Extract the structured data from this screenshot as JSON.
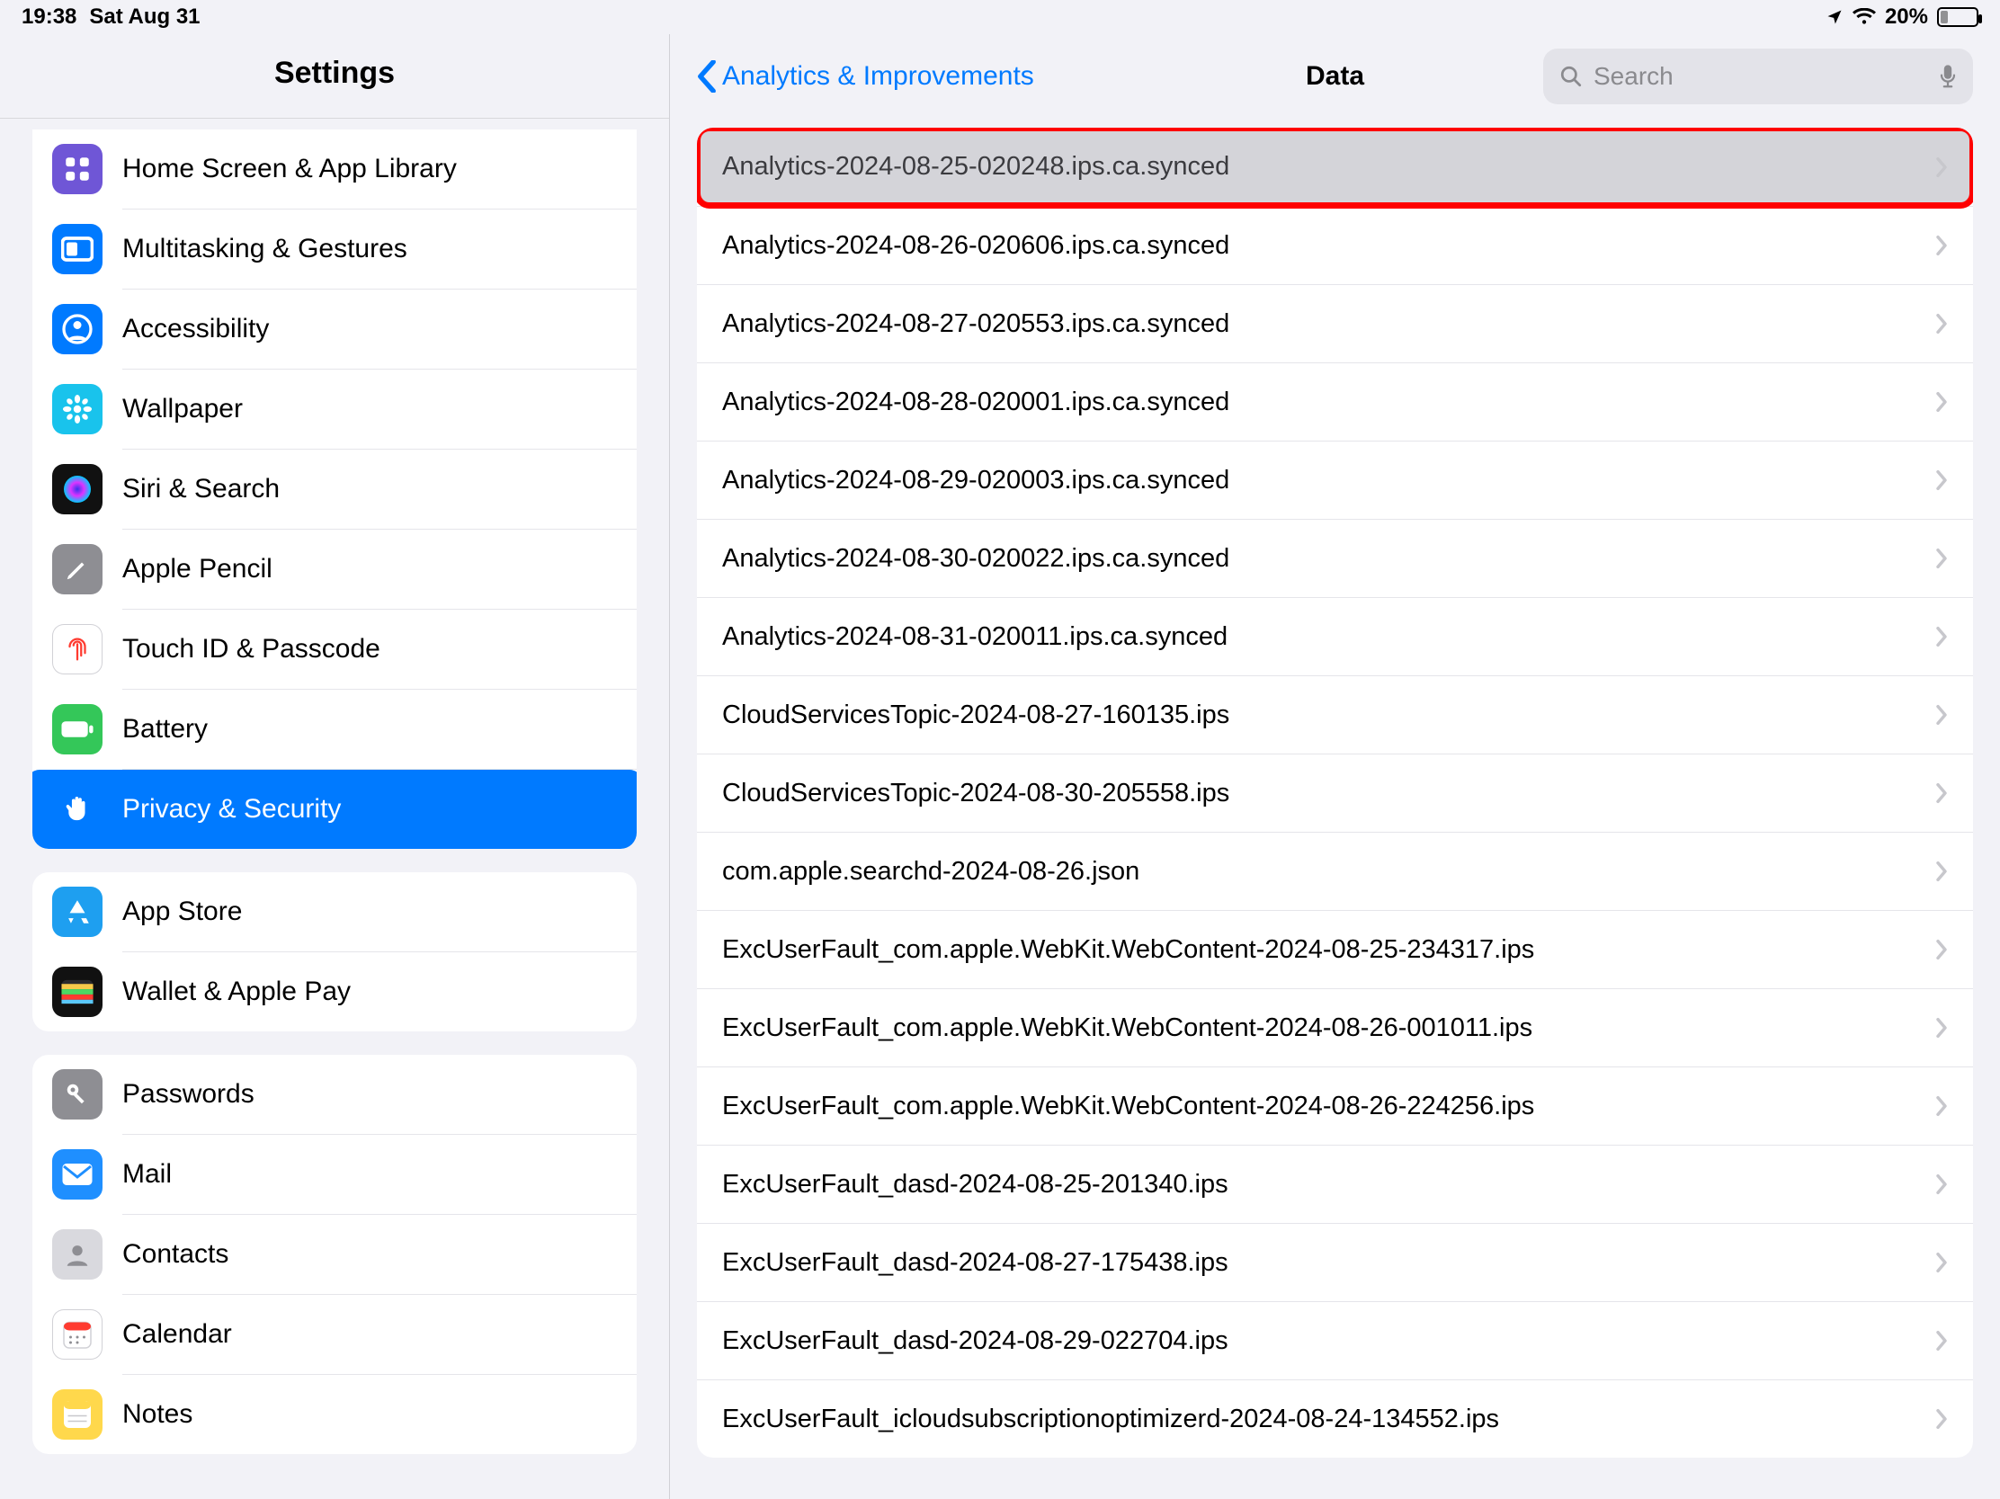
{
  "status": {
    "time": "19:38",
    "date": "Sat Aug 31",
    "battery_pct": "20%"
  },
  "sidebar": {
    "title": "Settings",
    "groups": [
      {
        "items": [
          {
            "id": "home-screen",
            "label": "Home Screen & App Library",
            "icon": "grid",
            "bg": "#6f56d6"
          },
          {
            "id": "multitasking",
            "label": "Multitasking & Gestures",
            "icon": "rect",
            "bg": "#007aff"
          },
          {
            "id": "accessibility",
            "label": "Accessibility",
            "icon": "person-circle",
            "bg": "#007aff"
          },
          {
            "id": "wallpaper",
            "label": "Wallpaper",
            "icon": "flower",
            "bg": "#19c3ec"
          },
          {
            "id": "siri",
            "label": "Siri & Search",
            "icon": "siri",
            "bg": "#111"
          },
          {
            "id": "apple-pencil",
            "label": "Apple Pencil",
            "icon": "pencil",
            "bg": "#8e8e93"
          },
          {
            "id": "touchid",
            "label": "Touch ID & Passcode",
            "icon": "fingerprint",
            "bg": "#fff",
            "fg": "#ff3b30",
            "border": true
          },
          {
            "id": "battery",
            "label": "Battery",
            "icon": "battery",
            "bg": "#34c759"
          },
          {
            "id": "privacy",
            "label": "Privacy & Security",
            "icon": "hand",
            "bg": "#007aff",
            "selected": true
          }
        ]
      },
      {
        "items": [
          {
            "id": "appstore",
            "label": "App Store",
            "icon": "appstore",
            "bg": "#1e9ff0"
          },
          {
            "id": "wallet",
            "label": "Wallet & Apple Pay",
            "icon": "wallet",
            "bg": "#111"
          }
        ]
      },
      {
        "items": [
          {
            "id": "passwords",
            "label": "Passwords",
            "icon": "key",
            "bg": "#8e8e93"
          },
          {
            "id": "mail",
            "label": "Mail",
            "icon": "mail",
            "bg": "#1f8fff"
          },
          {
            "id": "contacts",
            "label": "Contacts",
            "icon": "contacts",
            "bg": "#d9d9de"
          },
          {
            "id": "calendar",
            "label": "Calendar",
            "icon": "calendar",
            "bg": "#fff",
            "border": true
          },
          {
            "id": "notes",
            "label": "Notes",
            "icon": "notes",
            "bg": "#ffd84c"
          }
        ]
      }
    ]
  },
  "detail": {
    "back_label": "Analytics & Improvements",
    "title": "Data",
    "search_placeholder": "Search",
    "rows": [
      {
        "name": "Analytics-2024-08-25-020248.ips.ca.synced",
        "highlight": true
      },
      {
        "name": "Analytics-2024-08-26-020606.ips.ca.synced"
      },
      {
        "name": "Analytics-2024-08-27-020553.ips.ca.synced"
      },
      {
        "name": "Analytics-2024-08-28-020001.ips.ca.synced"
      },
      {
        "name": "Analytics-2024-08-29-020003.ips.ca.synced"
      },
      {
        "name": "Analytics-2024-08-30-020022.ips.ca.synced"
      },
      {
        "name": "Analytics-2024-08-31-020011.ips.ca.synced"
      },
      {
        "name": "CloudServicesTopic-2024-08-27-160135.ips"
      },
      {
        "name": "CloudServicesTopic-2024-08-30-205558.ips"
      },
      {
        "name": "com.apple.searchd-2024-08-26.json"
      },
      {
        "name": "ExcUserFault_com.apple.WebKit.WebContent-2024-08-25-234317.ips"
      },
      {
        "name": "ExcUserFault_com.apple.WebKit.WebContent-2024-08-26-001011.ips"
      },
      {
        "name": "ExcUserFault_com.apple.WebKit.WebContent-2024-08-26-224256.ips"
      },
      {
        "name": "ExcUserFault_dasd-2024-08-25-201340.ips"
      },
      {
        "name": "ExcUserFault_dasd-2024-08-27-175438.ips"
      },
      {
        "name": "ExcUserFault_dasd-2024-08-29-022704.ips"
      },
      {
        "name": "ExcUserFault_icloudsubscriptionoptimizerd-2024-08-24-134552.ips"
      }
    ]
  }
}
